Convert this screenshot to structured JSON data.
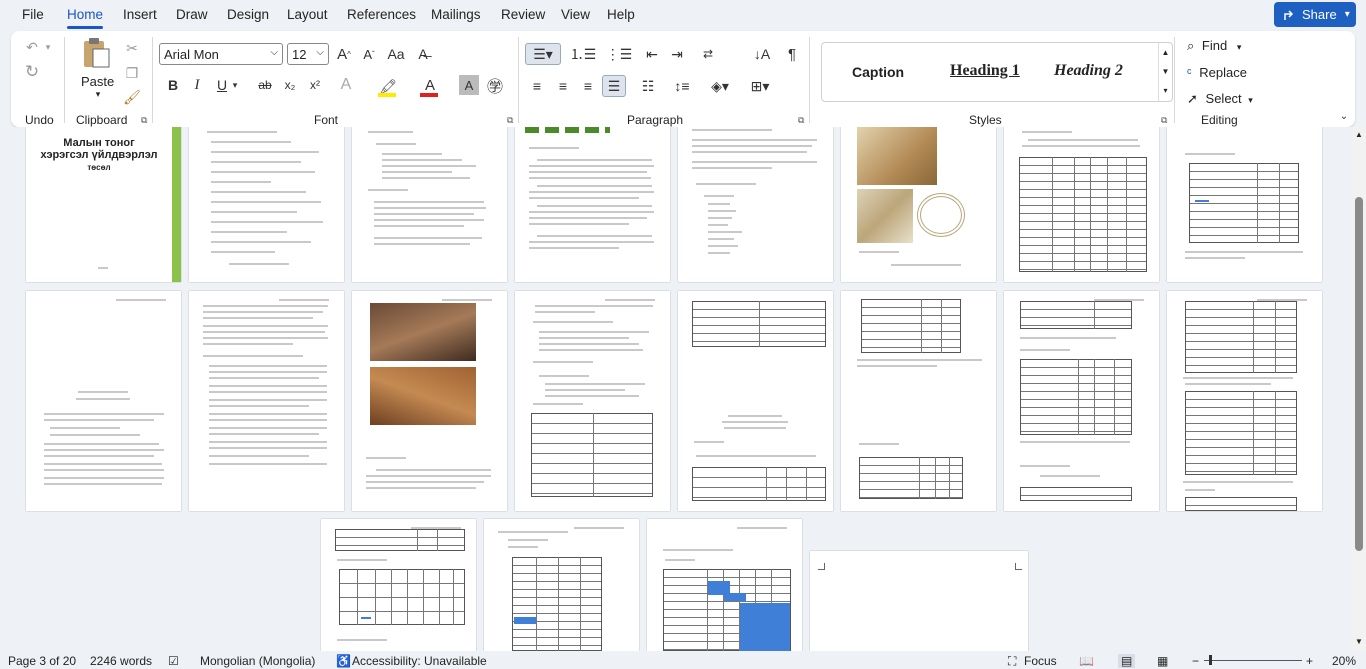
{
  "menu": {
    "items": [
      "File",
      "Home",
      "Insert",
      "Draw",
      "Design",
      "Layout",
      "References",
      "Mailings",
      "Review",
      "View",
      "Help"
    ],
    "active": "Home",
    "share_label": "Share"
  },
  "ribbon": {
    "groups": {
      "undo": "Undo",
      "clipboard": "Clipboard",
      "font": "Font",
      "paragraph": "Paragraph",
      "styles": "Styles",
      "editing": "Editing"
    },
    "paste_label": "Paste",
    "font_name": "Arial Mon",
    "font_size": "12",
    "styles": [
      "Caption",
      "Heading 1",
      "Heading 2"
    ],
    "editing": {
      "find": "Find",
      "replace": "Replace",
      "select": "Select"
    }
  },
  "document": {
    "cover_title": "Малын тоног хэрэгсэл үйлдвэрлэл",
    "cover_subtitle": "төсөл"
  },
  "status": {
    "page": "Page 3 of 20",
    "words": "2246 words",
    "language": "Mongolian (Mongolia)",
    "accessibility": "Accessibility: Unavailable",
    "focus": "Focus",
    "zoom": "20%"
  },
  "colors": {
    "accent": "#1a56c4",
    "share_bg": "#1e5fc2",
    "cover_green": "#8bc34a",
    "table_blue": "#3f7fd8"
  }
}
